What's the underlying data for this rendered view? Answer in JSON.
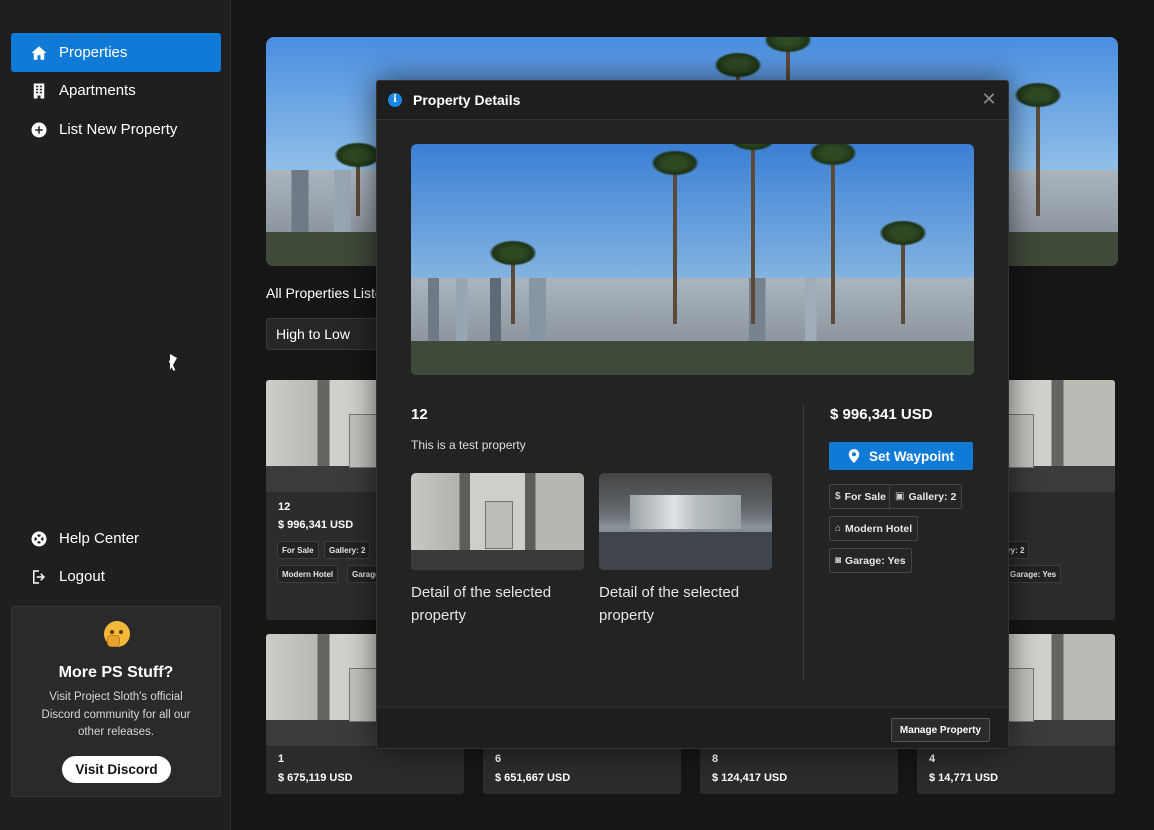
{
  "sidebar": {
    "nav": [
      {
        "label": "Properties",
        "icon": "home-icon",
        "active": true
      },
      {
        "label": "Apartments",
        "icon": "building-icon",
        "active": false
      },
      {
        "label": "List New Property",
        "icon": "plus-circle-icon",
        "active": false
      }
    ],
    "bottom_nav": [
      {
        "label": "Help Center",
        "icon": "lifebuoy-icon"
      },
      {
        "label": "Logout",
        "icon": "logout-icon"
      }
    ],
    "promo": {
      "title": "More PS Stuff?",
      "text": "Visit Project Sloth's official Discord community for all our other releases.",
      "button": "Visit Discord",
      "emoji": "thinking-face-icon"
    }
  },
  "main": {
    "list_title": "All Properties Listed",
    "sort": {
      "selected": "High to Low"
    },
    "cards_row1": [
      {
        "num": "12",
        "price": "$ 996,341 USD",
        "badges": [
          "For Sale",
          "Gallery: 2",
          "Modern Hotel",
          "Garage: Yes"
        ]
      },
      {
        "num": "",
        "price": "",
        "badges": [
          "Gallery: 2",
          "Garage: Yes"
        ]
      }
    ],
    "cards_row2": [
      {
        "num": "1",
        "price": "$ 675,119 USD"
      },
      {
        "num": "6",
        "price": "$ 651,667 USD"
      },
      {
        "num": "8",
        "price": "$ 124,417 USD"
      },
      {
        "num": "4",
        "price": "$ 14,771 USD"
      }
    ]
  },
  "modal": {
    "title": "Property Details",
    "name": "12",
    "description": "This is a test property",
    "image_alt": "Detail of the selected property",
    "price": "$ 996,341 USD",
    "waypoint_button": "Set Waypoint",
    "badges": {
      "for_sale": "For Sale",
      "gallery": "Gallery: 2",
      "type": "Modern Hotel",
      "garage": "Garage: Yes"
    },
    "manage_button": "Manage Property"
  },
  "colors": {
    "accent": "#0f7bd6",
    "background": "#161616",
    "panel": "#232323"
  }
}
